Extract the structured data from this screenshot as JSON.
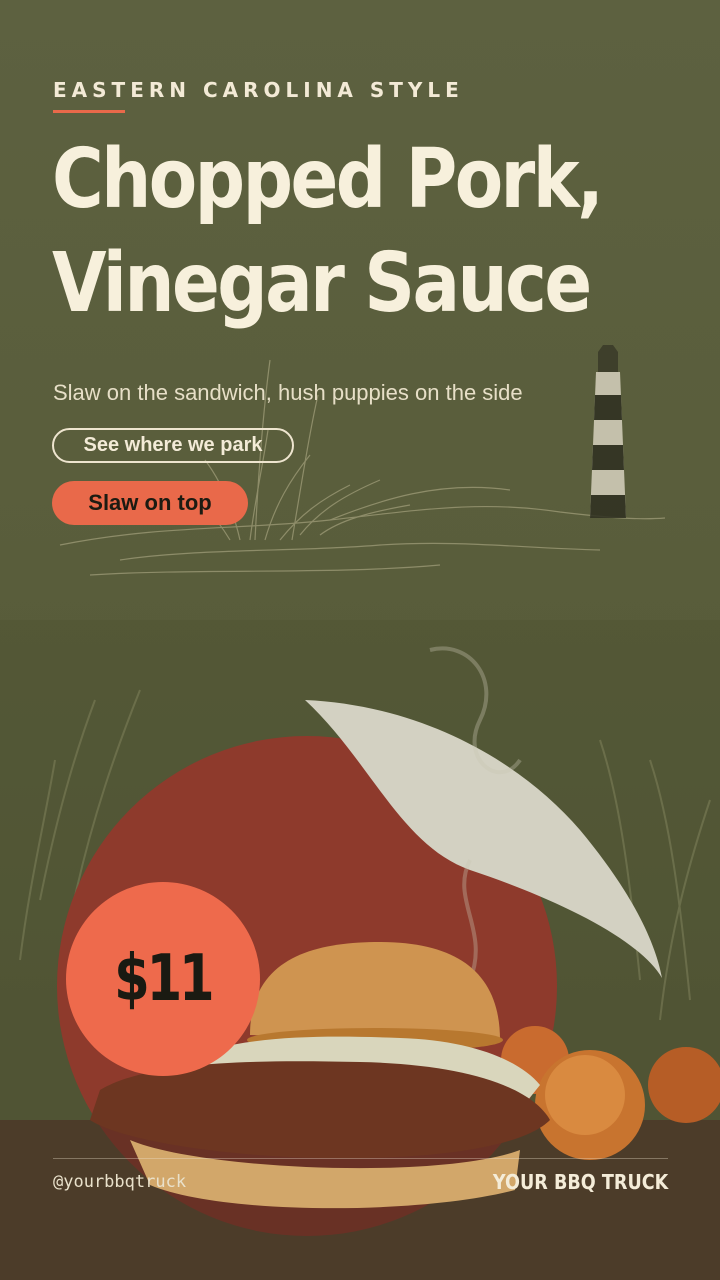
{
  "eyebrow": "EASTERN CAROLINA STYLE",
  "headline": {
    "line1": "Chopped Pork,",
    "line2": "Vinegar Sauce"
  },
  "subhead": "Slaw on the sandwich, hush puppies on the side",
  "buttons": {
    "park": "See where we park",
    "slaw": "Slaw on top"
  },
  "price": "$11",
  "footer": {
    "handle": "@yourbbqtruck",
    "brand": "YOUR BBQ TRUCK"
  },
  "colors": {
    "background": "#5a5e3b",
    "accent": "#e9694a",
    "text": "#f7f0dc"
  },
  "icons": [
    "lighthouse-illustration",
    "dune-grass-illustration"
  ]
}
